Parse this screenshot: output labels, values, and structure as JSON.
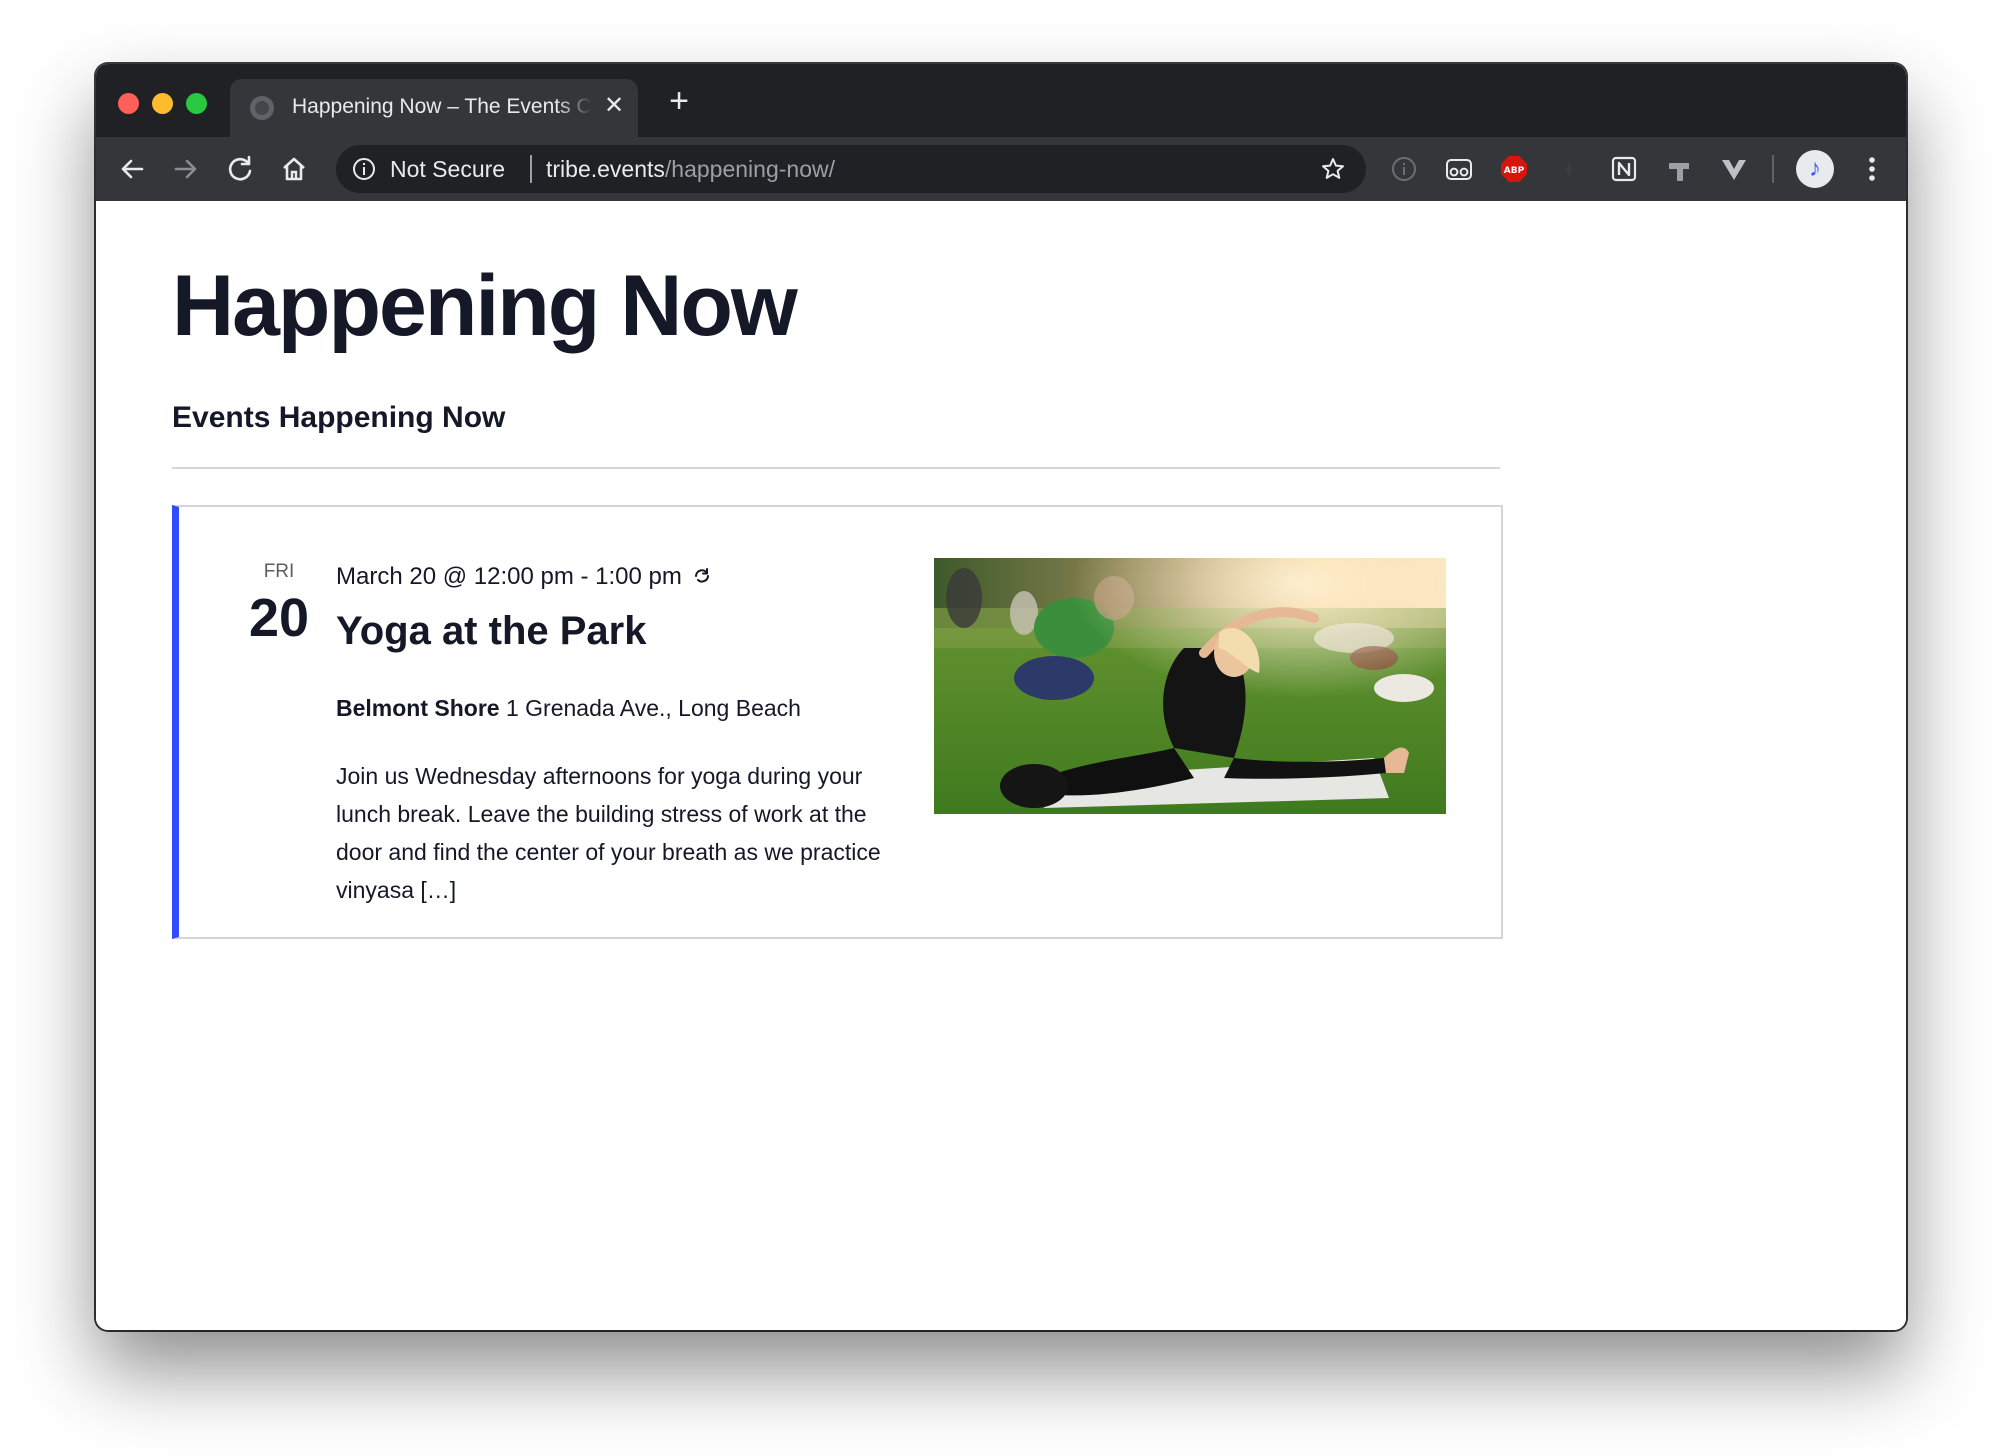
{
  "browser": {
    "tab": {
      "title": "Happening Now – The Events Calendar"
    },
    "omnibox": {
      "security_label": "Not Secure",
      "url_host": "tribe.events",
      "url_path": "/happening-now/"
    },
    "extensions": {
      "abp_label": "ABP"
    }
  },
  "page": {
    "title": "Happening Now",
    "section_heading": "Events Happening Now"
  },
  "event": {
    "weekday": "FRI",
    "day": "20",
    "datetime": "March 20 @ 12:00 pm - 1:00 pm",
    "title": "Yoga at the Park",
    "venue_name": "Belmont Shore",
    "venue_address": "1 Grenada Ave., Long Beach",
    "description": "Join us Wednesday afternoons for yoga during your lunch break. Leave the building stress of work at the door and find the center of your breath as we practice vinyasa […]"
  },
  "colors": {
    "accent": "#334aff",
    "text": "#141827",
    "chrome_dark": "#202124",
    "chrome_toolbar": "#35363a"
  }
}
